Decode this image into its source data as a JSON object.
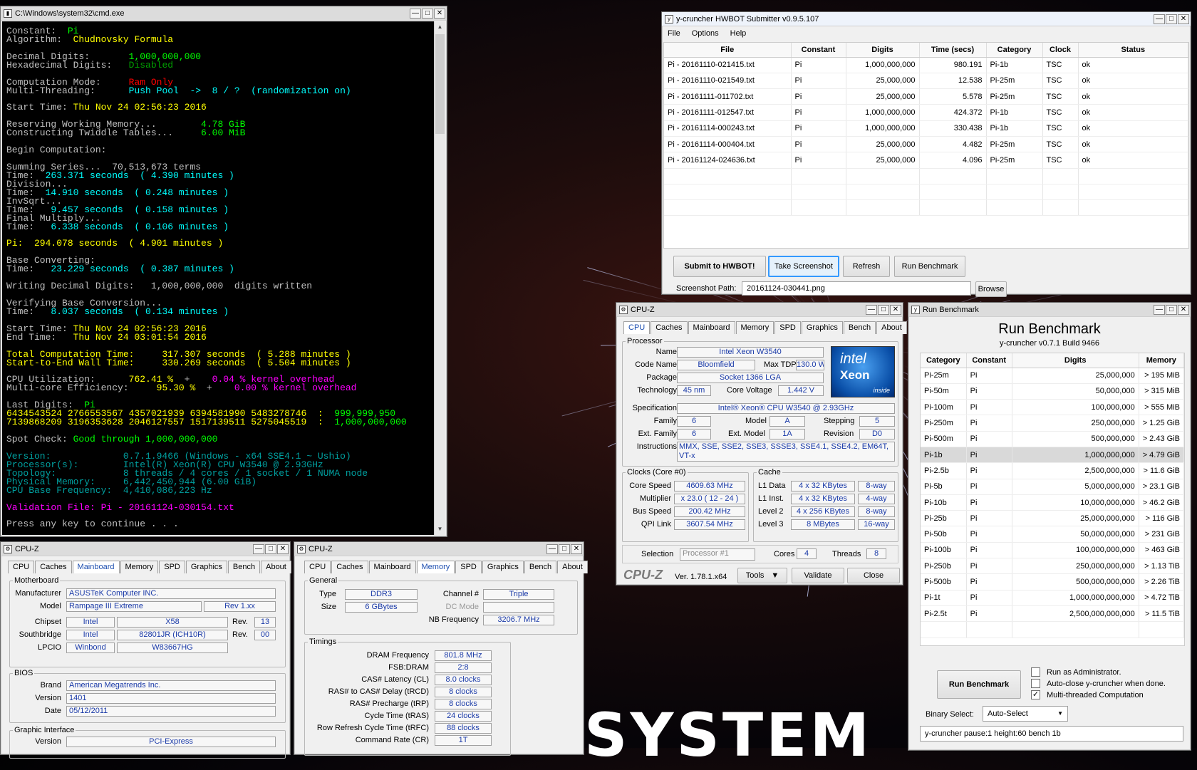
{
  "cmd": {
    "title": "C:\\Windows\\system32\\cmd.exe",
    "lines": [
      [
        [
          "Constant:  ",
          "w"
        ],
        [
          "Pi",
          "g"
        ]
      ],
      [
        [
          "Algorithm:  ",
          "w"
        ],
        [
          "Chudnovsky Formula",
          "y"
        ]
      ],
      [
        [
          "",
          ""
        ]
      ],
      [
        [
          "Decimal Digits:       ",
          "w"
        ],
        [
          "1,000,000,000",
          "g"
        ]
      ],
      [
        [
          "Hexadecimal Digits:   ",
          "w"
        ],
        [
          "Disabled",
          "dg"
        ]
      ],
      [
        [
          "",
          ""
        ]
      ],
      [
        [
          "Computation Mode:     ",
          "w"
        ],
        [
          "Ram Only",
          "r"
        ]
      ],
      [
        [
          "Multi-Threading:      ",
          "w"
        ],
        [
          "Push Pool  ->  8 / ?  (randomization on)",
          "c"
        ]
      ],
      [
        [
          "",
          ""
        ]
      ],
      [
        [
          "Start Time: ",
          "w"
        ],
        [
          "Thu Nov 24 02:56:23 2016",
          "y"
        ]
      ],
      [
        [
          "",
          ""
        ]
      ],
      [
        [
          "Reserving Working Memory...        ",
          "w"
        ],
        [
          "4.78 GiB",
          "g"
        ]
      ],
      [
        [
          "Constructing Twiddle Tables...     ",
          "w"
        ],
        [
          "6.00 MiB",
          "g"
        ]
      ],
      [
        [
          "",
          ""
        ]
      ],
      [
        [
          "Begin Computation:",
          "w"
        ]
      ],
      [
        [
          "",
          ""
        ]
      ],
      [
        [
          "Summing Series...  70,513,673 terms",
          "w"
        ]
      ],
      [
        [
          "Time:  ",
          "w"
        ],
        [
          "263.371 seconds  ( 4.390 minutes )",
          "c"
        ]
      ],
      [
        [
          "Division...",
          "w"
        ]
      ],
      [
        [
          "Time:  ",
          "w"
        ],
        [
          "14.910 seconds  ( 0.248 minutes )",
          "c"
        ]
      ],
      [
        [
          "InvSqrt...",
          "w"
        ]
      ],
      [
        [
          "Time:   ",
          "w"
        ],
        [
          "9.457 seconds  ( 0.158 minutes )",
          "c"
        ]
      ],
      [
        [
          "Final Multiply...",
          "w"
        ]
      ],
      [
        [
          "Time:   ",
          "w"
        ],
        [
          "6.338 seconds  ( 0.106 minutes )",
          "c"
        ]
      ],
      [
        [
          "",
          ""
        ]
      ],
      [
        [
          "Pi:  294.078 seconds  ( 4.901 minutes )",
          "y"
        ]
      ],
      [
        [
          "",
          ""
        ]
      ],
      [
        [
          "Base Converting:",
          "w"
        ]
      ],
      [
        [
          "Time:   ",
          "w"
        ],
        [
          "23.229 seconds  ( 0.387 minutes )",
          "c"
        ]
      ],
      [
        [
          "",
          ""
        ]
      ],
      [
        [
          "Writing Decimal Digits:   1,000,000,000  digits written",
          "w"
        ]
      ],
      [
        [
          "",
          ""
        ]
      ],
      [
        [
          "Verifying Base Conversion...",
          "w"
        ]
      ],
      [
        [
          "Time:   ",
          "w"
        ],
        [
          "8.037 seconds  ( 0.134 minutes )",
          "c"
        ]
      ],
      [
        [
          "",
          ""
        ]
      ],
      [
        [
          "Start Time: ",
          "w"
        ],
        [
          "Thu Nov 24 02:56:23 2016",
          "y"
        ]
      ],
      [
        [
          "End Time:   ",
          "w"
        ],
        [
          "Thu Nov 24 03:01:54 2016",
          "y"
        ]
      ],
      [
        [
          "",
          ""
        ]
      ],
      [
        [
          "Total Computation Time:     317.307 seconds  ( 5.288 minutes )",
          "y"
        ]
      ],
      [
        [
          "Start-to-End Wall Time:     330.269 seconds  ( 5.504 minutes )",
          "y"
        ]
      ],
      [
        [
          "",
          ""
        ]
      ],
      [
        [
          "CPU Utilization:      ",
          "w"
        ],
        [
          "762.41 %",
          "y"
        ],
        [
          "  +    ",
          "w"
        ],
        [
          "0.04 % kernel overhead",
          "m"
        ]
      ],
      [
        [
          "Multi-core Efficiency:     ",
          "w"
        ],
        [
          "95.30 %",
          "y"
        ],
        [
          "  +    ",
          "w"
        ],
        [
          "0.00 % kernel overhead",
          "m"
        ]
      ],
      [
        [
          "",
          ""
        ]
      ],
      [
        [
          "Last Digits:  ",
          "w"
        ],
        [
          "Pi",
          "g"
        ]
      ],
      [
        [
          "6434543524 2766553567 4357021939 6394581990 5483278746  :  ",
          "y"
        ],
        [
          "999,999,950",
          "g"
        ]
      ],
      [
        [
          "7139868209 3196353628 2046127557 1517139511 5275045519  :  ",
          "y"
        ],
        [
          "1,000,000,000",
          "g"
        ]
      ],
      [
        [
          "",
          ""
        ]
      ],
      [
        [
          "Spot Check: ",
          "w"
        ],
        [
          "Good through 1,000,000,000",
          "g"
        ]
      ],
      [
        [
          "",
          ""
        ]
      ],
      [
        [
          "Version:             0.7.1.9466 (Windows - x64 SSE4.1 ~ Ushio)",
          "tg"
        ]
      ],
      [
        [
          "Processor(s):        Intel(R) Xeon(R) CPU W3540 @ 2.93GHz",
          "tg"
        ]
      ],
      [
        [
          "Topology:            8 threads / 4 cores / 1 socket / 1 NUMA node",
          "tg"
        ]
      ],
      [
        [
          "Physical Memory:     6,442,450,944 (6.00 GiB)",
          "tg"
        ]
      ],
      [
        [
          "CPU Base Frequency:  4,410,086,223 Hz",
          "tg"
        ]
      ],
      [
        [
          "",
          ""
        ]
      ],
      [
        [
          "Validation File: Pi - 20161124-030154.txt",
          "m"
        ]
      ],
      [
        [
          "",
          ""
        ]
      ],
      [
        [
          "Press any key to continue . . .",
          "w"
        ]
      ]
    ]
  },
  "hwbot": {
    "title": "y-cruncher HWBOT Submitter v0.9.5.107",
    "menu": [
      "File",
      "Options",
      "Help"
    ],
    "columns": [
      "File",
      "Constant",
      "Digits",
      "Time (secs)",
      "Category",
      "Clock",
      "Status"
    ],
    "rows": [
      [
        "Pi - 20161110-021415.txt",
        "Pi",
        "1,000,000,000",
        "980.191",
        "Pi-1b",
        "TSC",
        "ok"
      ],
      [
        "Pi - 20161110-021549.txt",
        "Pi",
        "25,000,000",
        "12.538",
        "Pi-25m",
        "TSC",
        "ok"
      ],
      [
        "Pi - 20161111-011702.txt",
        "Pi",
        "25,000,000",
        "5.578",
        "Pi-25m",
        "TSC",
        "ok"
      ],
      [
        "Pi - 20161111-012547.txt",
        "Pi",
        "1,000,000,000",
        "424.372",
        "Pi-1b",
        "TSC",
        "ok"
      ],
      [
        "Pi - 20161114-000243.txt",
        "Pi",
        "1,000,000,000",
        "330.438",
        "Pi-1b",
        "TSC",
        "ok"
      ],
      [
        "Pi - 20161114-000404.txt",
        "Pi",
        "25,000,000",
        "4.482",
        "Pi-25m",
        "TSC",
        "ok"
      ],
      [
        "Pi - 20161124-024636.txt",
        "Pi",
        "25,000,000",
        "4.096",
        "Pi-25m",
        "TSC",
        "ok"
      ]
    ],
    "buttons": {
      "submit": "Submit to HWBOT!",
      "screenshot": "Take Screenshot",
      "refresh": "Refresh",
      "run": "Run Benchmark"
    },
    "path_label": "Screenshot Path:",
    "path_value": "20161124-030441.png",
    "browse": "Browse"
  },
  "cpuz": {
    "title": "CPU-Z",
    "tabs": [
      "CPU",
      "Caches",
      "Mainboard",
      "Memory",
      "SPD",
      "Graphics",
      "Bench",
      "About"
    ],
    "processor": "Processor",
    "name_l": "Name",
    "name": "Intel Xeon W3540",
    "code_l": "Code Name",
    "code": "Bloomfield",
    "tdp_l": "Max TDP",
    "tdp": "130.0 W",
    "pkg_l": "Package",
    "pkg": "Socket 1366 LGA",
    "tech_l": "Technology",
    "tech": "45 nm",
    "cv_l": "Core Voltage",
    "cv": "1.442 V",
    "spec_l": "Specification",
    "spec": "Intel® Xeon® CPU     W3540  @ 2.93GHz",
    "fam_l": "Family",
    "fam": "6",
    "mod_l": "Model",
    "mod": "A",
    "step_l": "Stepping",
    "step": "5",
    "efam_l": "Ext. Family",
    "efam": "6",
    "emod_l": "Ext. Model",
    "emod": "1A",
    "rev_l": "Revision",
    "rev": "D0",
    "ins_l": "Instructions",
    "ins": "MMX, SSE, SSE2, SSE3, SSSE3, SSE4.1, SSE4.2, EM64T, VT-x",
    "clocks": "Clocks (Core #0)",
    "cs_l": "Core Speed",
    "cs": "4609.63 MHz",
    "mu_l": "Multiplier",
    "mu": "x 23.0 ( 12 - 24 )",
    "bs_l": "Bus Speed",
    "bs": "200.42 MHz",
    "qpi_l": "QPI Link",
    "qpi": "3607.54 MHz",
    "cache": "Cache",
    "l1d_l": "L1 Data",
    "l1d": "4 x 32 KBytes",
    "l1d_w": "8-way",
    "l1i_l": "L1 Inst.",
    "l1i": "4 x 32 KBytes",
    "l1i_w": "4-way",
    "l2_l": "Level 2",
    "l2": "4 x 256 KBytes",
    "l2_w": "8-way",
    "l3_l": "Level 3",
    "l3": "8 MBytes",
    "l3_w": "16-way",
    "sel_l": "Selection",
    "sel": "Processor #1",
    "cores_l": "Cores",
    "cores": "4",
    "thr_l": "Threads",
    "thr": "8",
    "brand": "CPU-Z",
    "ver": "Ver. 1.78.1.x64",
    "tools": "Tools",
    "validate": "Validate",
    "close": "Close",
    "logo1": "intel",
    "logo2": "Xeon",
    "logo3": "inside"
  },
  "bench": {
    "title": "Run Benchmark",
    "heading": "Run Benchmark",
    "sub": "y-cruncher v0.7.1 Build 9466",
    "columns": [
      "Category",
      "Constant",
      "Digits",
      "Memory"
    ],
    "rows": [
      [
        "Pi-25m",
        "Pi",
        "25,000,000",
        "> 195 MiB"
      ],
      [
        "Pi-50m",
        "Pi",
        "50,000,000",
        "> 315 MiB"
      ],
      [
        "Pi-100m",
        "Pi",
        "100,000,000",
        "> 555 MiB"
      ],
      [
        "Pi-250m",
        "Pi",
        "250,000,000",
        "> 1.25 GiB"
      ],
      [
        "Pi-500m",
        "Pi",
        "500,000,000",
        "> 2.43 GiB"
      ],
      [
        "Pi-1b",
        "Pi",
        "1,000,000,000",
        "> 4.79 GiB"
      ],
      [
        "Pi-2.5b",
        "Pi",
        "2,500,000,000",
        "> 11.6 GiB"
      ],
      [
        "Pi-5b",
        "Pi",
        "5,000,000,000",
        "> 23.1 GiB"
      ],
      [
        "Pi-10b",
        "Pi",
        "10,000,000,000",
        "> 46.2 GiB"
      ],
      [
        "Pi-25b",
        "Pi",
        "25,000,000,000",
        "> 116 GiB"
      ],
      [
        "Pi-50b",
        "Pi",
        "50,000,000,000",
        "> 231 GiB"
      ],
      [
        "Pi-100b",
        "Pi",
        "100,000,000,000",
        "> 463 GiB"
      ],
      [
        "Pi-250b",
        "Pi",
        "250,000,000,000",
        "> 1.13 TiB"
      ],
      [
        "Pi-500b",
        "Pi",
        "500,000,000,000",
        "> 2.26 TiB"
      ],
      [
        "Pi-1t",
        "Pi",
        "1,000,000,000,000",
        "> 4.72 TiB"
      ],
      [
        "Pi-2.5t",
        "Pi",
        "2,500,000,000,000",
        "> 11.5 TiB"
      ]
    ],
    "selected_row": 5,
    "run": "Run Benchmark",
    "opt1": "Run as Administrator.",
    "opt2": "Auto-close y-cruncher when done.",
    "opt3": "Multi-threaded Computation",
    "bin_l": "Binary Select:",
    "bin": "Auto-Select",
    "cmdline": "y-cruncher pause:1 height:60 bench 1b"
  },
  "mb": {
    "title": "CPU-Z",
    "motherboard": "Motherboard",
    "man_l": "Manufacturer",
    "man": "ASUSTeK Computer INC.",
    "model_l": "Model",
    "model": "Rampage III Extreme",
    "modrev": "Rev 1.xx",
    "chip_l": "Chipset",
    "chip1": "Intel",
    "chip2": "X58",
    "rev_l": "Rev.",
    "chiprev": "13",
    "sb_l": "Southbridge",
    "sb1": "Intel",
    "sb2": "82801JR (ICH10R)",
    "sbrev": "00",
    "lpc_l": "LPCIO",
    "lpc1": "Winbond",
    "lpc2": "W83667HG",
    "bios": "BIOS",
    "brand_l": "Brand",
    "brand": "American Megatrends Inc.",
    "ver_l": "Version",
    "ver": "1401",
    "date_l": "Date",
    "date": "05/12/2011",
    "gi": "Graphic Interface",
    "giver_l": "Version",
    "giver": "PCI-Express"
  },
  "mem": {
    "title": "CPU-Z",
    "general": "General",
    "type_l": "Type",
    "type": "DDR3",
    "size_l": "Size",
    "size": "6 GBytes",
    "ch_l": "Channel #",
    "ch": "Triple",
    "dc_l": "DC Mode",
    "nb_l": "NB Frequency",
    "nb": "3206.7 MHz",
    "timings": "Timings",
    "dram_l": "DRAM Frequency",
    "dram": "801.8 MHz",
    "fsb_l": "FSB:DRAM",
    "fsb": "2:8",
    "cl_l": "CAS# Latency (CL)",
    "cl": "8.0 clocks",
    "rcd_l": "RAS# to CAS# Delay (tRCD)",
    "rcd": "8 clocks",
    "rp_l": "RAS# Precharge (tRP)",
    "rp": "8 clocks",
    "ras_l": "Cycle Time (tRAS)",
    "ras": "24 clocks",
    "rfc_l": "Row Refresh Cycle Time (tRFC)",
    "rfc": "88 clocks",
    "cr_l": "Command Rate (CR)",
    "cr": "1T"
  },
  "desktop": {
    "word": "SYSTEM"
  }
}
